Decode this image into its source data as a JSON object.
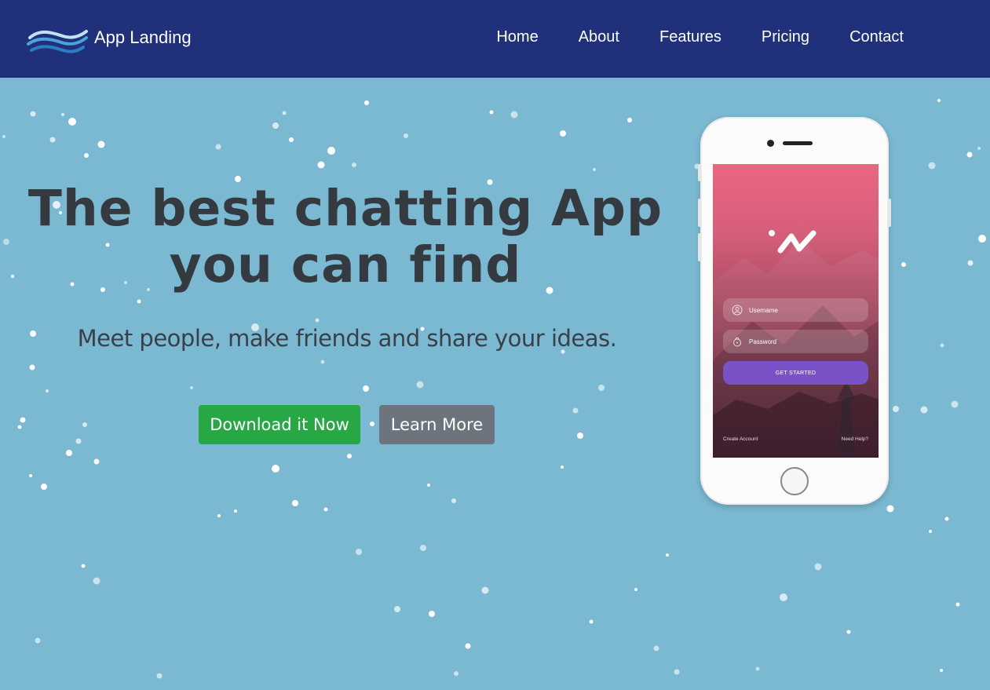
{
  "colors": {
    "navbar": "#21307a",
    "hero_bg": "#7bb8d1",
    "download_button": "#28a745",
    "learn_button": "#6c757d",
    "get_started_button": "#7a52c8"
  },
  "navbar": {
    "brand": "App Landing",
    "logo_icon": "waves-logo-icon",
    "links": [
      {
        "label": "Home"
      },
      {
        "label": "About"
      },
      {
        "label": "Features"
      },
      {
        "label": "Pricing"
      },
      {
        "label": "Contact"
      }
    ]
  },
  "hero": {
    "title_line1": "The best chatting App",
    "title_line2": "you can find",
    "subtitle": "Meet people, make friends and share your ideas.",
    "primary_button": "Download it Now",
    "secondary_button": "Learn More"
  },
  "phone": {
    "app_logo_icon": "app-logo-icon",
    "username_placeholder": "Username",
    "password_placeholder": "Password",
    "get_started": "GET STARTED",
    "create_account": "Create Account",
    "need_help": "Need Help?"
  }
}
